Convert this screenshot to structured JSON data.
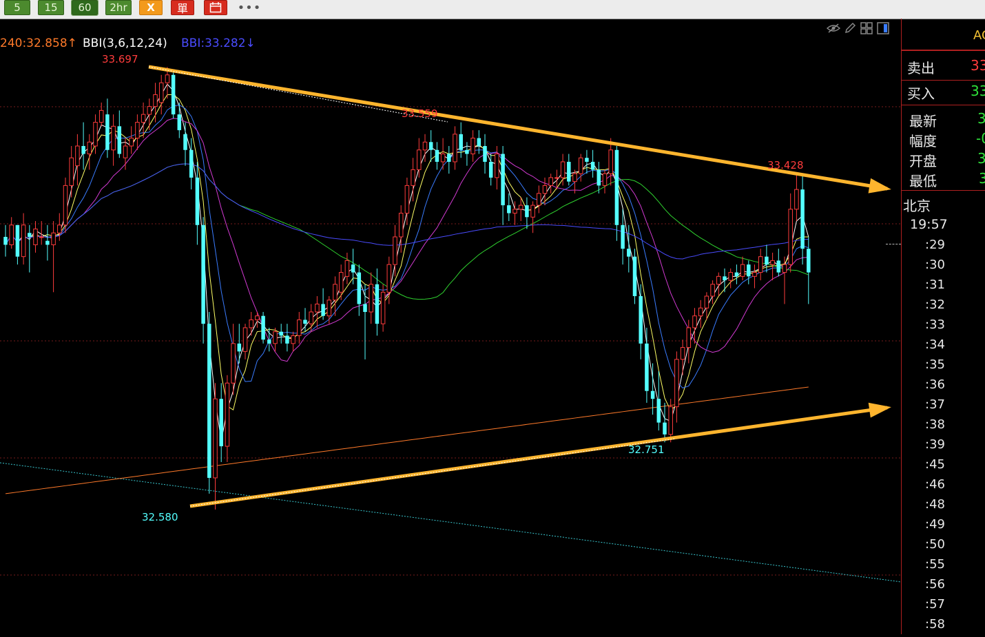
{
  "toolbar": {
    "periods": [
      "5",
      "15",
      "60",
      "2hr"
    ],
    "active_period": "60",
    "x_label": "X",
    "red1_label": "單",
    "red2_icon": "calendar-icon",
    "more_label": "•••"
  },
  "legend": {
    "ma240": "240:32.858↑",
    "bbi_name": "BBI(3,6,12,24)",
    "bbi_value": "BBI:33.282↓"
  },
  "colors": {
    "up": "#ff3c3c",
    "down": "#54ffff",
    "ma240": "#ff7a2a",
    "bbi": "#4a4cff",
    "arrow": "#ffb52e",
    "panel_border": "#b02020"
  },
  "chart_data": {
    "type": "candlestick",
    "annotations": {
      "high_left": "33.697",
      "high_mid": "33.559",
      "high_right": "33.428",
      "low_left": "32.580",
      "low_right": "32.751"
    },
    "ohlc": [
      [
        33.27,
        33.3,
        33.22,
        33.25
      ],
      [
        33.25,
        33.32,
        33.24,
        33.3
      ],
      [
        33.3,
        33.3,
        33.2,
        33.22
      ],
      [
        33.22,
        33.33,
        33.2,
        33.3
      ],
      [
        33.28,
        33.3,
        33.18,
        33.27
      ],
      [
        33.25,
        33.31,
        33.23,
        33.29
      ],
      [
        33.27,
        33.31,
        33.25,
        33.27
      ],
      [
        33.26,
        33.3,
        33.21,
        33.25
      ],
      [
        33.25,
        33.31,
        33.13,
        33.28
      ],
      [
        33.28,
        33.33,
        33.26,
        33.3
      ],
      [
        33.3,
        33.42,
        33.28,
        33.4
      ],
      [
        33.4,
        33.5,
        33.37,
        33.47
      ],
      [
        33.45,
        33.53,
        33.4,
        33.5
      ],
      [
        33.5,
        33.56,
        33.44,
        33.48
      ],
      [
        33.48,
        33.53,
        33.44,
        33.51
      ],
      [
        33.5,
        33.58,
        33.48,
        33.56
      ],
      [
        33.56,
        33.61,
        33.55,
        33.59
      ],
      [
        33.58,
        33.62,
        33.47,
        33.49
      ],
      [
        33.49,
        33.58,
        33.45,
        33.55
      ],
      [
        33.55,
        33.59,
        33.47,
        33.48
      ],
      [
        33.47,
        33.52,
        33.44,
        33.5
      ],
      [
        33.5,
        33.55,
        33.48,
        33.52
      ],
      [
        33.52,
        33.58,
        33.49,
        33.56
      ],
      [
        33.56,
        33.61,
        33.52,
        33.58
      ],
      [
        33.58,
        33.62,
        33.54,
        33.6
      ],
      [
        33.6,
        33.66,
        33.56,
        33.63
      ],
      [
        33.61,
        33.68,
        33.58,
        33.66
      ],
      [
        33.66,
        33.7,
        33.62,
        33.68
      ],
      [
        33.68,
        33.69,
        33.57,
        33.58
      ],
      [
        33.58,
        33.61,
        33.52,
        33.54
      ],
      [
        33.53,
        33.56,
        33.45,
        33.49
      ],
      [
        33.49,
        33.52,
        33.39,
        33.42
      ],
      [
        33.42,
        33.46,
        33.25,
        33.3
      ],
      [
        33.3,
        33.32,
        33.0,
        33.05
      ],
      [
        33.05,
        33.08,
        32.62,
        32.66
      ],
      [
        32.66,
        32.9,
        32.58,
        32.86
      ],
      [
        32.86,
        32.9,
        32.7,
        32.74
      ],
      [
        32.74,
        32.92,
        32.7,
        32.9
      ],
      [
        32.9,
        33.05,
        32.87,
        33.0
      ],
      [
        33.0,
        33.05,
        32.95,
        32.98
      ],
      [
        32.98,
        33.05,
        32.96,
        33.04
      ],
      [
        33.04,
        33.08,
        33.02,
        33.06
      ],
      [
        33.06,
        33.08,
        33.04,
        33.07
      ],
      [
        33.07,
        33.08,
        33.0,
        33.01
      ],
      [
        33.01,
        33.04,
        32.98,
        33.0
      ],
      [
        33.0,
        33.04,
        32.98,
        33.03
      ],
      [
        33.03,
        33.05,
        33.0,
        33.02
      ],
      [
        33.02,
        33.05,
        32.98,
        33.0
      ],
      [
        33.0,
        33.03,
        32.98,
        33.02
      ],
      [
        33.02,
        33.08,
        33.0,
        33.06
      ],
      [
        33.06,
        33.09,
        33.03,
        33.05
      ],
      [
        33.05,
        33.1,
        33.03,
        33.08
      ],
      [
        33.08,
        33.12,
        33.04,
        33.1
      ],
      [
        33.1,
        33.14,
        33.06,
        33.07
      ],
      [
        33.07,
        33.12,
        33.05,
        33.11
      ],
      [
        33.11,
        33.17,
        33.07,
        33.15
      ],
      [
        33.13,
        33.2,
        33.11,
        33.18
      ],
      [
        33.17,
        33.23,
        33.15,
        33.21
      ],
      [
        33.2,
        33.24,
        33.15,
        33.18
      ],
      [
        33.18,
        33.2,
        33.07,
        33.1
      ],
      [
        33.1,
        33.15,
        32.96,
        33.08
      ],
      [
        33.08,
        33.18,
        33.05,
        33.15
      ],
      [
        33.15,
        33.19,
        33.02,
        33.05
      ],
      [
        33.05,
        33.15,
        33.03,
        33.13
      ],
      [
        33.13,
        33.22,
        33.1,
        33.2
      ],
      [
        33.2,
        33.3,
        33.17,
        33.27
      ],
      [
        33.27,
        33.35,
        33.23,
        33.33
      ],
      [
        33.33,
        33.42,
        33.3,
        33.4
      ],
      [
        33.4,
        33.47,
        33.36,
        33.44
      ],
      [
        33.44,
        33.52,
        33.42,
        33.49
      ],
      [
        33.49,
        33.53,
        33.46,
        33.51
      ],
      [
        33.51,
        33.54,
        33.46,
        33.49
      ],
      [
        33.49,
        33.51,
        33.44,
        33.46
      ],
      [
        33.46,
        33.52,
        33.44,
        33.48
      ],
      [
        33.48,
        33.5,
        33.43,
        33.46
      ],
      [
        33.46,
        33.55,
        33.44,
        33.53
      ],
      [
        33.53,
        33.56,
        33.47,
        33.49
      ],
      [
        33.49,
        33.51,
        33.45,
        33.48
      ],
      [
        33.48,
        33.54,
        33.46,
        33.52
      ],
      [
        33.52,
        33.54,
        33.48,
        33.5
      ],
      [
        33.5,
        33.53,
        33.43,
        33.46
      ],
      [
        33.46,
        33.48,
        33.4,
        33.42
      ],
      [
        33.42,
        33.5,
        33.39,
        33.48
      ],
      [
        33.48,
        33.5,
        33.3,
        33.35
      ],
      [
        33.35,
        33.38,
        33.31,
        33.33
      ],
      [
        33.33,
        33.36,
        33.3,
        33.34
      ],
      [
        33.34,
        33.37,
        33.31,
        33.35
      ],
      [
        33.35,
        33.37,
        33.29,
        33.32
      ],
      [
        33.32,
        33.36,
        33.28,
        33.35
      ],
      [
        33.35,
        33.4,
        33.33,
        33.38
      ],
      [
        33.38,
        33.42,
        33.35,
        33.4
      ],
      [
        33.4,
        33.43,
        33.38,
        33.42
      ],
      [
        33.42,
        33.44,
        33.39,
        33.42
      ],
      [
        33.42,
        33.48,
        33.4,
        33.46
      ],
      [
        33.46,
        33.48,
        33.4,
        33.41
      ],
      [
        33.41,
        33.44,
        33.38,
        33.43
      ],
      [
        33.43,
        33.48,
        33.41,
        33.47
      ],
      [
        33.47,
        33.49,
        33.43,
        33.46
      ],
      [
        33.46,
        33.49,
        33.42,
        33.44
      ],
      [
        33.44,
        33.46,
        33.38,
        33.4
      ],
      [
        33.4,
        33.44,
        33.38,
        33.43
      ],
      [
        33.43,
        33.52,
        33.4,
        33.49
      ],
      [
        33.49,
        33.5,
        33.26,
        33.3
      ],
      [
        33.3,
        33.34,
        33.2,
        33.24
      ],
      [
        33.24,
        33.3,
        33.18,
        33.22
      ],
      [
        33.22,
        33.24,
        33.1,
        33.12
      ],
      [
        33.12,
        33.15,
        32.96,
        33.0
      ],
      [
        33.0,
        33.04,
        32.85,
        32.88
      ],
      [
        32.88,
        32.95,
        32.82,
        32.86
      ],
      [
        32.86,
        32.93,
        32.78,
        32.8
      ],
      [
        32.8,
        32.85,
        32.75,
        32.77
      ],
      [
        32.77,
        32.86,
        32.75,
        32.84
      ],
      [
        32.84,
        32.98,
        32.8,
        32.96
      ],
      [
        32.96,
        33.01,
        32.92,
        32.99
      ],
      [
        32.99,
        33.06,
        32.95,
        33.04
      ],
      [
        33.04,
        33.09,
        33.0,
        33.07
      ],
      [
        33.07,
        33.11,
        33.04,
        33.09
      ],
      [
        33.09,
        33.13,
        33.06,
        33.12
      ],
      [
        33.12,
        33.16,
        33.1,
        33.15
      ],
      [
        33.15,
        33.18,
        33.12,
        33.17
      ],
      [
        33.17,
        33.19,
        33.13,
        33.16
      ],
      [
        33.16,
        33.19,
        33.14,
        33.18
      ],
      [
        33.18,
        33.2,
        33.15,
        33.17
      ],
      [
        33.17,
        33.22,
        33.16,
        33.2
      ],
      [
        33.2,
        33.21,
        33.15,
        33.17
      ],
      [
        33.17,
        33.2,
        33.14,
        33.18
      ],
      [
        33.18,
        33.24,
        33.16,
        33.22
      ],
      [
        33.22,
        33.25,
        33.18,
        33.2
      ],
      [
        33.2,
        33.23,
        33.16,
        33.21
      ],
      [
        33.21,
        33.24,
        33.17,
        33.18
      ],
      [
        33.18,
        33.22,
        33.1,
        33.2
      ],
      [
        33.2,
        33.38,
        33.18,
        33.34
      ],
      [
        33.34,
        33.43,
        33.31,
        33.39
      ],
      [
        33.39,
        33.43,
        33.2,
        33.24
      ],
      [
        33.24,
        33.27,
        33.1,
        33.18
      ]
    ]
  },
  "panel": {
    "top_label": "AG",
    "sell_label": "卖出",
    "sell_value": "33",
    "buy_label": "买入",
    "buy_value": "33",
    "rows": [
      {
        "label": "最新",
        "value": "3"
      },
      {
        "label": "幅度",
        "value": "-0"
      },
      {
        "label": "开盘",
        "value": "3"
      },
      {
        "label": "最低",
        "value": "3"
      }
    ],
    "tz_label": "北京",
    "first_time": "19:57",
    "times": [
      ":29",
      ":30",
      ":31",
      ":32",
      ":33",
      ":34",
      ":35",
      ":36",
      ":37",
      ":38",
      ":39",
      ":45",
      ":46",
      ":48",
      ":49",
      ":50",
      ":55",
      ":56",
      ":57",
      ":58"
    ]
  }
}
